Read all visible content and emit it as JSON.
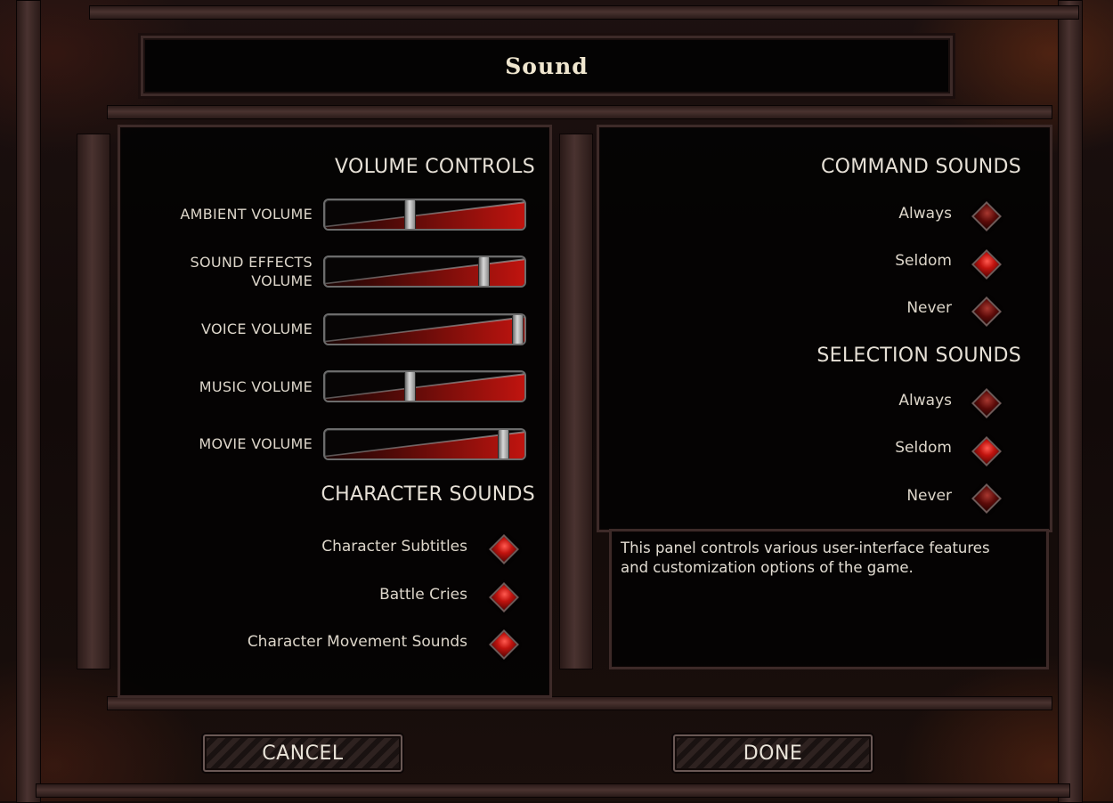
{
  "window": {
    "title": "Sound"
  },
  "volume_controls": {
    "title": "VOLUME CONTROLS",
    "sliders": [
      {
        "label_lines": [
          "AMBIENT VOLUME"
        ],
        "value_fraction": 0.42
      },
      {
        "label_lines": [
          "SOUND EFFECTS",
          "VOLUME"
        ],
        "value_fraction": 0.79
      },
      {
        "label_lines": [
          "VOICE VOLUME"
        ],
        "value_fraction": 0.96
      },
      {
        "label_lines": [
          "MUSIC VOLUME"
        ],
        "value_fraction": 0.42
      },
      {
        "label_lines": [
          "MOVIE VOLUME"
        ],
        "value_fraction": 0.89
      }
    ]
  },
  "character_sounds": {
    "title": "CHARACTER SOUNDS",
    "options": [
      {
        "label": "Character Subtitles",
        "checked": true
      },
      {
        "label": "Battle Cries",
        "checked": true
      },
      {
        "label": "Character Movement Sounds",
        "checked": true
      }
    ]
  },
  "command_sounds": {
    "title": "COMMAND SOUNDS",
    "options": [
      {
        "label": "Always",
        "selected": false
      },
      {
        "label": "Seldom",
        "selected": true
      },
      {
        "label": "Never",
        "selected": false
      }
    ]
  },
  "selection_sounds": {
    "title": "SELECTION SOUNDS",
    "options": [
      {
        "label": "Always",
        "selected": false
      },
      {
        "label": "Seldom",
        "selected": true
      },
      {
        "label": "Never",
        "selected": false
      }
    ]
  },
  "description": "This panel controls various user-interface features and customization options of the game.",
  "buttons": {
    "cancel": "CANCEL",
    "done": "DONE"
  },
  "colors": {
    "accent_red": "#c1140f",
    "panel_bg": "#040303",
    "frame": "#3d2a28",
    "text": "#ddd6ca"
  }
}
